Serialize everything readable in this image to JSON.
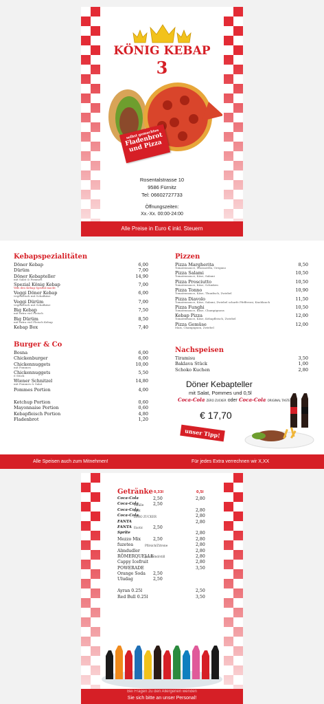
{
  "page1": {
    "title": "KÖNIG KEBAP",
    "number": "3",
    "badge": {
      "line1": "selbst gemachtes",
      "line2": "Fladenbrot",
      "line3": "und Pizza"
    },
    "address": {
      "street": "Rosentalstrasse 10",
      "city": "9586 Fürnitz",
      "phone": "Tel: 06602727733"
    },
    "hours_label": "Öffnungszeiten:",
    "hours_value": "Xx.-Xx. 00:00-24:00",
    "footer": "Alle Preise in Euro € inkl. Steuern"
  },
  "page2": {
    "kebab": {
      "title": "Kebapspezialitäten",
      "items": [
        {
          "name": "Döner Kebap",
          "price": "6,00",
          "desc": ""
        },
        {
          "name": "Dürüm",
          "price": "7,00",
          "desc": ""
        },
        {
          "name": "Döner Kebapteller",
          "price": "14,90",
          "desc": "mit Salat & Pommes"
        },
        {
          "name": "Spezial König Kebap",
          "price": "7,00",
          "desc": "Was den Kebap Spezial macht"
        },
        {
          "name": "Veggi Döner Kebap",
          "price": "6,00",
          "desc": "vegetarisch mit Schafkäse"
        },
        {
          "name": "Veggi Dürüm",
          "price": "7,00",
          "desc": "vegetarisch mit Schafkäse"
        },
        {
          "name": "Big Kebap",
          "price": "7,50",
          "desc": "mit extra viel Fleisch"
        },
        {
          "name": "Big Dürüm",
          "price": "8,50",
          "desc": "mit extra viel Fleisch Kebap"
        },
        {
          "name": "Kebap Box",
          "price": "7,40",
          "desc": ""
        }
      ]
    },
    "burger": {
      "title": "Burger & Co",
      "items": [
        {
          "name": "Bosna",
          "price": "6,00",
          "desc": ""
        },
        {
          "name": "Chickenburger",
          "price": "6,00",
          "desc": ""
        },
        {
          "name": "Chickennuggets",
          "price": "10,00",
          "desc": "mit Pommes"
        },
        {
          "name": "Chickennuggets",
          "price": "5,50",
          "desc": "6 Stück"
        },
        {
          "name": "Wiener Schnitzel",
          "price": "14,80",
          "desc": "mit Pommes & Salat"
        },
        {
          "name": "Pommes Portion",
          "price": "4,00",
          "desc": ""
        }
      ],
      "extras": [
        {
          "name": "Ketchup Portion",
          "price": "0,60"
        },
        {
          "name": "Mayonnaise Portion",
          "price": "0,60"
        },
        {
          "name": "Kebapfleisch Portion",
          "price": "4,80"
        },
        {
          "name": "Fladenbrot",
          "price": "1,20"
        }
      ]
    },
    "pizza": {
      "title": "Pizzen",
      "items": [
        {
          "name": "Pizza Margherita",
          "price": "8,50",
          "desc": "Tomatensauce, Mozzarella, Oregano"
        },
        {
          "name": "Pizza Salami",
          "price": "10,50",
          "desc": "Tomatensauce, Käse, Salami"
        },
        {
          "name": "Pizza Prosciutto",
          "price": "10,50",
          "desc": "Tomatensauce, Käse, Schinken"
        },
        {
          "name": "Pizza Tonno",
          "price": "10,90",
          "desc": "Tomatensauce, Käse, Thunfisch, Zwiebel"
        },
        {
          "name": "Pizza Diavolo",
          "price": "11,50",
          "desc": "Tomatensauce, Käse, Salami, Zwiebel scharfe Pfefferoni, Knoblauch"
        },
        {
          "name": "Pizza Funghi",
          "price": "10,50",
          "desc": "Tomatensauce, Käse, Champignons"
        },
        {
          "name": "Kebap Pizza",
          "price": "12,00",
          "desc": "Tomatensauce, Käse, Kebapfleisch, Zwiebel"
        },
        {
          "name": "Pizza Gemüse",
          "price": "12,00",
          "desc": "Mais, Champignon, Zwiebel"
        }
      ]
    },
    "dessert": {
      "title": "Nachspeisen",
      "items": [
        {
          "name": "Tiramisu",
          "price": "3,50"
        },
        {
          "name": "Baklava Stück",
          "price": "1,00"
        },
        {
          "name": "Schoko Kuchen",
          "price": "2,80"
        }
      ]
    },
    "promo": {
      "title": "Döner Kebapteller",
      "subtitle": "mit Salat, Pommes und 0,5l",
      "brand1": "Coca-Cola",
      "brand1_note": "ZERO ZUCKER",
      "oder": "oder",
      "brand2": "Coca-Cola",
      "brand2_note": "ORIGINAL TASTE",
      "price": "€ 17,70",
      "tip": "unser Tipp!"
    },
    "footer_left": "Alle Speisen auch zum Mitnehmen!",
    "footer_right": "Für jedes Extra verrechnen wir X,XX"
  },
  "page3": {
    "title": "Getränke",
    "col1": "0,33l",
    "col2": "0,5l",
    "drinks": [
      {
        "name": "Coca-Cola",
        "note": "",
        "p1": "2,50",
        "p2": "2,80"
      },
      {
        "name": "Coca-Cola",
        "note": "Vanille",
        "p1": "2,50",
        "p2": ""
      },
      {
        "name": "Coca-Cola",
        "note": "light",
        "p1": "",
        "p2": "2,80"
      },
      {
        "name": "Coca-Cola",
        "note": "ZERO ZUCKER",
        "p1": "",
        "p2": "2,80"
      },
      {
        "name": "FANTA",
        "note": "",
        "p1": "",
        "p2": "2,80"
      },
      {
        "name": "FANTA",
        "note": "Exotic",
        "p1": "2,50",
        "p2": ""
      },
      {
        "name": "Sprite",
        "note": "",
        "p1": "",
        "p2": "2,80"
      },
      {
        "name": "Mezzo Mix",
        "note": "",
        "p1": "2,50",
        "p2": "2,80"
      },
      {
        "name": "fuzetea",
        "note": "Pfirsich/Zitrone",
        "p1": "",
        "p2": "2,80"
      },
      {
        "name": "Almdudler",
        "note": "",
        "p1": "",
        "p2": "2,80"
      },
      {
        "name": "RÖMERQUELLE",
        "note": "prickelnd/still",
        "p1": "",
        "p2": "2,80"
      },
      {
        "name": "Cappy Icefruit",
        "note": "",
        "p1": "",
        "p2": "2,80"
      },
      {
        "name": "POWERADE",
        "note": "",
        "p1": "",
        "p2": "3,50"
      },
      {
        "name": "Orange Soda",
        "note": "",
        "p1": "2,50",
        "p2": ""
      },
      {
        "name": "Uludag",
        "note": "",
        "p1": "2,50",
        "p2": ""
      },
      {
        "name": "",
        "note": "",
        "p1": "",
        "p2": ""
      },
      {
        "name": "Ayran 0.25l",
        "note": "",
        "p1": "",
        "p2": "2,50"
      },
      {
        "name": "Red Bull 0.25l",
        "note": "",
        "p1": "",
        "p2": "3,50"
      }
    ],
    "footer_top": "Bei Fragen zu den Allergenen wenden",
    "footer": "Sie sich bitte an unser Personal!"
  },
  "colors": {
    "accent": "#d61f26",
    "gold": "#f2c21b"
  }
}
